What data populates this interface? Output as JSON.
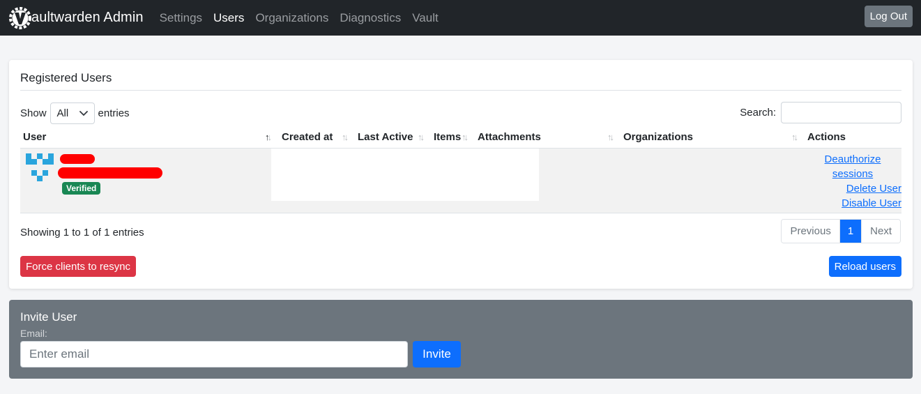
{
  "navbar": {
    "brand": "aultwarden Admin",
    "links": [
      "Settings",
      "Users",
      "Organizations",
      "Diagnostics",
      "Vault"
    ],
    "logout_label": "Log Out"
  },
  "users_card": {
    "title": "Registered Users",
    "show_label": "Show",
    "length_value": "All",
    "entries_label": "entries",
    "search_label": "Search:",
    "search_value": "",
    "columns": [
      "User",
      "Created at",
      "Last Active",
      "Items",
      "Attachments",
      "Organizations",
      "Actions"
    ],
    "rows": [
      {
        "badge": "Verified",
        "actions": [
          "Deauthorize",
          "sessions",
          "Delete User",
          "Disable User"
        ]
      }
    ],
    "info": "Showing 1 to 1 of 1 entries",
    "pagination": {
      "previous": "Previous",
      "current": "1",
      "next": "Next"
    },
    "force_resync_label": "Force clients to resync",
    "reload_label": "Reload users"
  },
  "invite": {
    "title": "Invite User",
    "email_label": "Email:",
    "email_placeholder": "Enter email",
    "button_label": "Invite"
  },
  "colors": {
    "navbar": "#212529",
    "primary": "#0d6efd",
    "danger": "#dc3545",
    "success": "#198754",
    "secondary": "#6c757d"
  }
}
